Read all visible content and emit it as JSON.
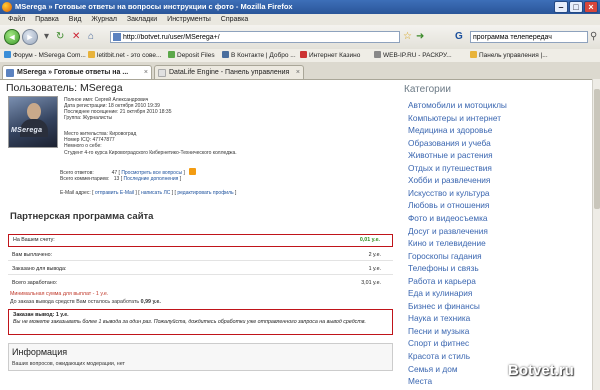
{
  "window": {
    "title": "MSerega » Готовые ответы на вопросы инструкции с фото - Mozilla Firefox"
  },
  "menu": [
    "Файл",
    "Правка",
    "Вид",
    "Журнал",
    "Закладки",
    "Инструменты",
    "Справка"
  ],
  "nav": {
    "url": "http://botvet.ru/user/MSerega+/",
    "search_value": "программа телепередач"
  },
  "bookmarks": [
    "Форум - MSerega Com...",
    "letitbit.net - это сове...",
    "Deposit Files",
    "В Контакте | Добро ...",
    "Интернет Казино",
    "WEB-IP.RU - РАСКРУ...",
    "Панель управления |..."
  ],
  "tabs": [
    {
      "label": "MSerega » Готовые ответы на ..."
    },
    {
      "label": "DataLife Engine - Панель управления"
    }
  ],
  "profile": {
    "title": "Пользователь: MSerega",
    "avatar_text": "MSerega",
    "full_name": "Полное имя: Сергей Александрович",
    "reg_date": "Дата регистрации: 18 октября 2010 19:39",
    "last_visit": "Последнее посещение: 21 октября 2010 18:35",
    "group": "Группа: Журналисты",
    "location": "Место жительства: Кировоград",
    "icq": "Номер ICQ: 47747877",
    "about_label": "Немного о себе:",
    "about": "Студент 4-го курса Кировоградского Кибернетико-Технического колледжа.",
    "answers_label": "Всего ответов:",
    "answers_count": "47",
    "answers_link": "Просмотреть все вопросы",
    "comments_label": "Всего комментариев:",
    "comments_count": "13",
    "comments_link": "Последние дополнения",
    "email_label": "E-Mail адрес:",
    "email_link": "отправить E-Mail",
    "pm_link": "написать ЛС",
    "edit_link": "редактировать профиль"
  },
  "partner": {
    "title": "Партнерская программа сайта",
    "rows": [
      {
        "label": "На Вашем счету:",
        "value": "0,01 у.е."
      },
      {
        "label": "Вам выплачено:",
        "value": "2 у.е."
      },
      {
        "label": "Заказано для вывода:",
        "value": "1 у.е."
      },
      {
        "label": "Всего заработано:",
        "value": "3,01 у.е."
      }
    ],
    "min_payout": "Минимальная сумма для выплат - 1 у.е.",
    "remaining_label": "До заказа вывода средств Вам осталось заработать",
    "remaining_value": "0,99 у.е.",
    "order_title": "Заказан вывод: 1 у.е.",
    "order_text": "Вы не можете заказывать более 1 вывода за один раз. Пожалуйста, дождитесь обработки уже отправленного запроса на вывод средств."
  },
  "info": {
    "title": "Информация",
    "text": "Ваших вопросов, ожидающих модерации, нет"
  },
  "sidebar": {
    "title": "Категории",
    "items": [
      "Автомобили и мотоциклы",
      "Компьютеры и интернет",
      "Медицина и здоровье",
      "Образования и учеба",
      "Животные и растения",
      "Отдых и путешествия",
      "Хобби и развлечения",
      "Искусство и культура",
      "Любовь и отношения",
      "Фото и видеосъемка",
      "Досуг и развлечения",
      "Кино и телевидение",
      "Гороскопы гадания",
      "Телефоны и связь",
      "Работа и карьера",
      "Еда и кулинария",
      "Бизнес и финансы",
      "Наука и техника",
      "Песни и музыка",
      "Спорт и фитнес",
      "Красота и стиль",
      "Семья и дом",
      "Места"
    ]
  },
  "watermark": "Botvet.ru",
  "colors": {
    "accent": "#3a66b0",
    "highlight_border": "#c0141a",
    "balance_value": "#2e8b1e"
  }
}
